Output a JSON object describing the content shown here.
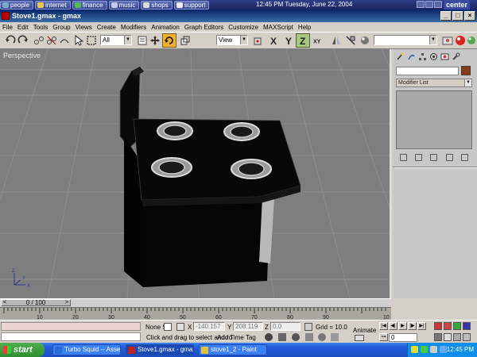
{
  "linkbar": {
    "items": [
      {
        "label": "people",
        "icon": "people-icon"
      },
      {
        "label": "internet",
        "icon": "internet-icon"
      },
      {
        "label": "finance",
        "icon": "finance-icon"
      },
      {
        "label": "music",
        "icon": "music-icon"
      },
      {
        "label": "shops",
        "icon": "shops-icon"
      },
      {
        "label": "support",
        "icon": "support-icon"
      }
    ],
    "datetime": "12:45 PM Tuesday, June 22, 2004",
    "brand": "center"
  },
  "window": {
    "title": "Stove1.gmax - gmax",
    "menu": [
      "File",
      "Edit",
      "Tools",
      "Group",
      "Views",
      "Create",
      "Modifiers",
      "Animation",
      "Graph Editors",
      "Customize",
      "MAXScript",
      "Help"
    ]
  },
  "toolbar": {
    "selection_filter": "All",
    "ref_coord": "View",
    "snap_label": "3",
    "axis_x": "X",
    "axis_y": "Y",
    "axis_z": "Z",
    "axis_xy": "XY"
  },
  "viewport": {
    "label": "Perspective",
    "gizmo_axes": {
      "x": "X",
      "y": "Y",
      "z": "Z"
    }
  },
  "command_panel": {
    "modifier_list": "Modifier List",
    "object_color": "#8a3a14"
  },
  "timeline": {
    "frame": "0 / 100",
    "ticks": [
      "10",
      "20",
      "30",
      "40",
      "50",
      "60",
      "70",
      "80",
      "90",
      "10"
    ]
  },
  "status": {
    "selection": "None S",
    "x_label": "X",
    "x_value": "-140.157",
    "y_label": "Y",
    "y_value": "208.119",
    "z_label": "Z",
    "z_value": "0.0",
    "grid": "Grid = 10.0",
    "animate": "Animate",
    "prompt": "Click and drag to select and ro",
    "add_time_tag": "Add Time Tag",
    "frame_field": "0"
  },
  "taskbar": {
    "start": "start",
    "tasks": [
      {
        "label": "Turbo Squid -- Asset ...",
        "icon_color": "#2a6ad8"
      },
      {
        "label": "Stove1.gmax - gmax",
        "icon_color": "#c02020"
      },
      {
        "label": "stove1_2 - Paint",
        "icon_color": "#e0c040"
      }
    ],
    "clock": "12:45 PM"
  }
}
